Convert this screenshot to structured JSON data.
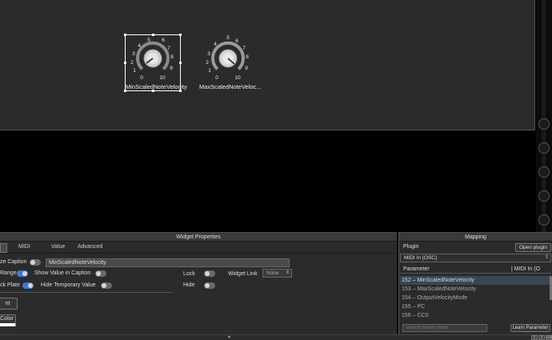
{
  "knobs": [
    {
      "caption": "MinScaledNoteVelocity",
      "ticks": [
        "0",
        "1",
        "2",
        "3",
        "4",
        "5",
        "6",
        "7",
        "8",
        "9",
        "10"
      ],
      "selected": true
    },
    {
      "caption": "MaxScaledNoteVeloc...",
      "ticks": [
        "0",
        "1",
        "2",
        "3",
        "4",
        "5",
        "6",
        "7",
        "8",
        "9",
        "10"
      ],
      "selected": false
    }
  ],
  "widget_properties": {
    "title": "Widget Properties",
    "tabs": [
      "MIDI",
      "Value",
      "Advanced"
    ],
    "caption_label": "ze Caption",
    "caption_value": "MinScaledNoteVelocity",
    "range_label": "Range",
    "show_value_label": "Show Value in Caption",
    "lock_label": "Lock",
    "widget_link_label": "Widget Link",
    "widget_link_value": "None",
    "plate_label": "ck Plate",
    "hide_temp_label": "Hide Temporary Value",
    "hide_label": "Hide",
    "font_button": "nt",
    "color_button": "Color"
  },
  "mapping": {
    "title": "Mapping",
    "plugin_label": "Plugin",
    "open_plugin": "Open plugin",
    "plugin_select": "MIDI In (OSC)",
    "col_parameter": "Parameter",
    "col_midi": "| MIDI In (O",
    "rows": [
      "152 – MinScaledNoteVelocity",
      "153 – MaxScaledNoteVelocity",
      "154 – OutputVelocityMode",
      "155 – PC",
      "156 – CC0"
    ],
    "search_placeholder": "search param name",
    "learn_button": "Learn Parameter"
  },
  "bottom": {
    "mini_buttons": [
      "1",
      "2",
      "out"
    ],
    "up_arrow": "▲"
  }
}
